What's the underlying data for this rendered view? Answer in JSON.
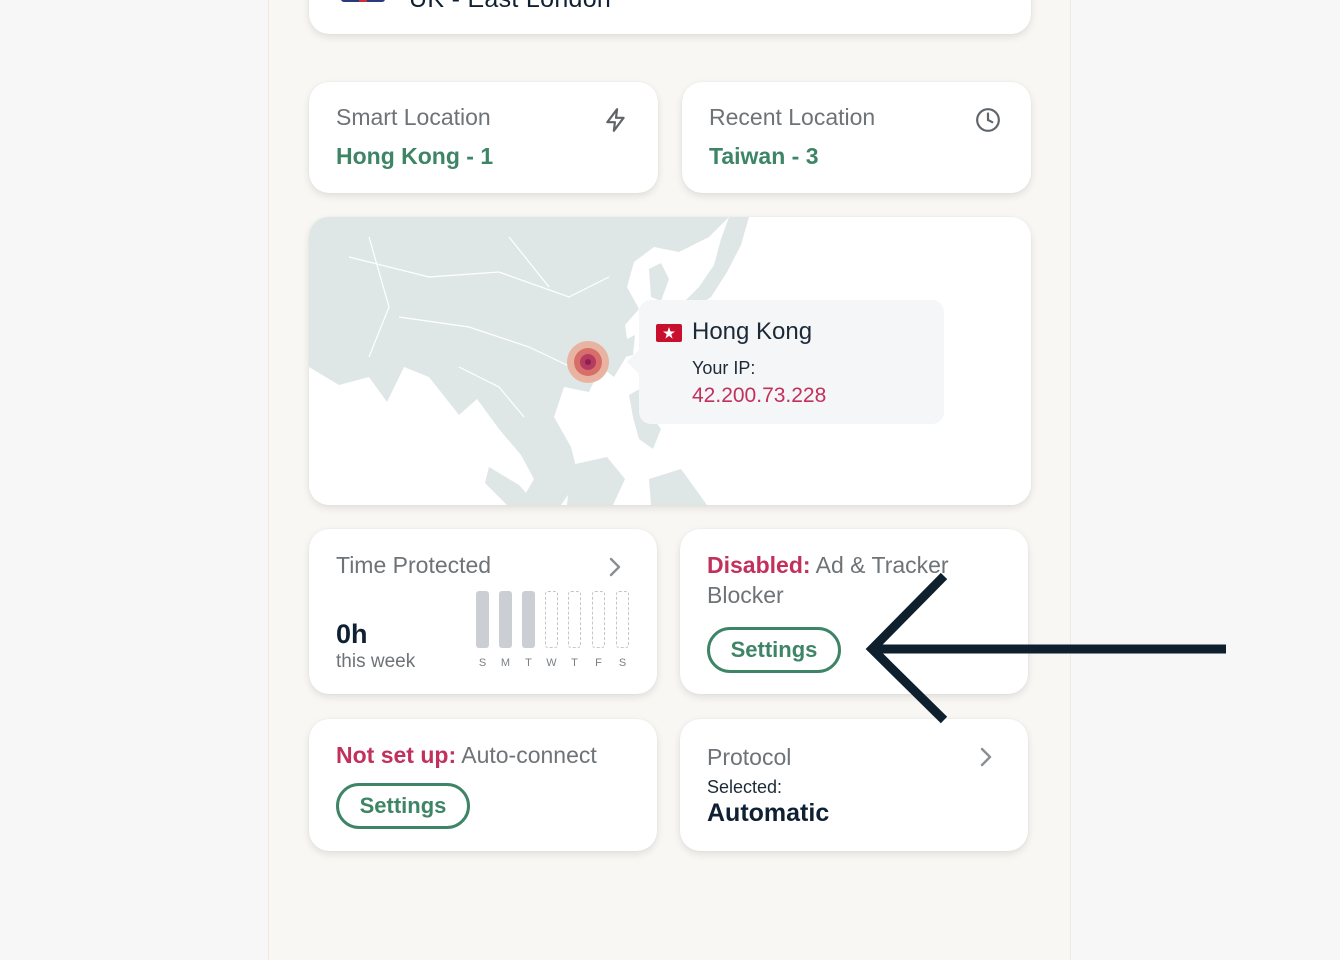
{
  "current_connection": {
    "label": "UK - East London"
  },
  "smart_location": {
    "title": "Smart Location",
    "value": "Hong Kong - 1",
    "icon": "lightning-icon"
  },
  "recent_location": {
    "title": "Recent Location",
    "value": "Taiwan - 3",
    "icon": "clock-icon"
  },
  "map": {
    "country": "Hong Kong",
    "ip_label": "Your IP:",
    "ip": "42.200.73.228"
  },
  "time_protected": {
    "title": "Time Protected",
    "value": "0h",
    "sub": "this week",
    "days": [
      "S",
      "M",
      "T",
      "W",
      "T",
      "F",
      "S"
    ],
    "filled_days": 3
  },
  "ad_blocker": {
    "status": "Disabled:",
    "label": "Ad & Tracker",
    "label_line2": "Blocker",
    "button": "Settings"
  },
  "auto_connect": {
    "status": "Not set up:",
    "label": "Auto-connect",
    "button": "Settings"
  },
  "protocol": {
    "title": "Protocol",
    "selected_label": "Selected:",
    "value": "Automatic"
  },
  "colors": {
    "accent_green": "#3e8466",
    "alert_pink": "#c2315c",
    "text_dark": "#102033"
  }
}
